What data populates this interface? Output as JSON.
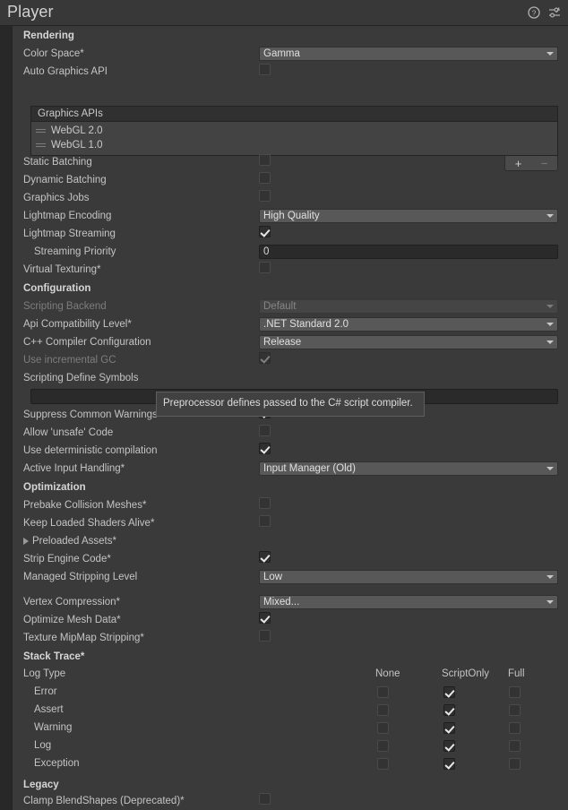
{
  "header": {
    "title": "Player",
    "help_icon": "help-circle-icon",
    "preset_icon": "preset-settings-icon"
  },
  "sections": {
    "rendering": {
      "title": "Rendering",
      "color_space": {
        "label": "Color Space*",
        "value": "Gamma"
      },
      "auto_graphics_api": {
        "label": "Auto Graphics API",
        "checked": false
      },
      "graphics_apis": {
        "header": "Graphics APIs",
        "items": [
          "WebGL 2.0",
          "WebGL 1.0"
        ],
        "add_label": "+",
        "remove_label": "−"
      },
      "static_batching": {
        "label": "Static Batching",
        "checked": false
      },
      "dynamic_batching": {
        "label": "Dynamic Batching",
        "checked": false
      },
      "graphics_jobs": {
        "label": "Graphics Jobs",
        "checked": false
      },
      "lightmap_encoding": {
        "label": "Lightmap Encoding",
        "value": "High Quality"
      },
      "lightmap_streaming": {
        "label": "Lightmap Streaming",
        "checked": true
      },
      "streaming_priority": {
        "label": "Streaming Priority",
        "value": "0"
      },
      "virtual_texturing": {
        "label": "Virtual Texturing*",
        "checked": false
      }
    },
    "configuration": {
      "title": "Configuration",
      "scripting_backend": {
        "label": "Scripting Backend",
        "value": "Default",
        "disabled": true
      },
      "api_compatibility_level": {
        "label": "Api Compatibility Level*",
        "value": ".NET Standard 2.0"
      },
      "cpp_compiler_configuration": {
        "label": "C++ Compiler Configuration",
        "value": "Release"
      },
      "use_incremental_gc": {
        "label": "Use incremental GC",
        "checked": true,
        "disabled": true
      },
      "scripting_define_symbols": {
        "label": "Scripting Define Symbols",
        "value": ""
      },
      "suppress_common_warnings": {
        "label": "Suppress Common Warnings",
        "checked": true
      },
      "allow_unsafe_code": {
        "label": "Allow 'unsafe' Code",
        "checked": false
      },
      "use_deterministic_compilation": {
        "label": "Use deterministic compilation",
        "checked": true
      },
      "active_input_handling": {
        "label": "Active Input Handling*",
        "value": "Input Manager (Old)"
      }
    },
    "optimization": {
      "title": "Optimization",
      "prebake_collision_meshes": {
        "label": "Prebake Collision Meshes*",
        "checked": false
      },
      "keep_loaded_shaders_alive": {
        "label": "Keep Loaded Shaders Alive*",
        "checked": false
      },
      "preloaded_assets": {
        "label": "Preloaded Assets*"
      },
      "strip_engine_code": {
        "label": "Strip Engine Code*",
        "checked": true
      },
      "managed_stripping_level": {
        "label": "Managed Stripping Level",
        "value": "Low"
      },
      "vertex_compression": {
        "label": "Vertex Compression*",
        "value": "Mixed..."
      },
      "optimize_mesh_data": {
        "label": "Optimize Mesh Data*",
        "checked": true
      },
      "texture_mipmap_stripping": {
        "label": "Texture MipMap Stripping*",
        "checked": false
      }
    },
    "stack_trace": {
      "title": "Stack Trace*",
      "row_header": "Log Type",
      "columns": [
        "None",
        "ScriptOnly",
        "Full"
      ],
      "rows": [
        {
          "label": "Error",
          "selected": "ScriptOnly"
        },
        {
          "label": "Assert",
          "selected": "ScriptOnly"
        },
        {
          "label": "Warning",
          "selected": "ScriptOnly"
        },
        {
          "label": "Log",
          "selected": "ScriptOnly"
        },
        {
          "label": "Exception",
          "selected": "ScriptOnly"
        }
      ]
    },
    "legacy": {
      "title": "Legacy",
      "clamp_blendshapes": {
        "label": "Clamp BlendShapes (Deprecated)*",
        "checked": false
      }
    }
  },
  "tooltip": {
    "text": "Preprocessor defines passed to the C# script compiler."
  }
}
